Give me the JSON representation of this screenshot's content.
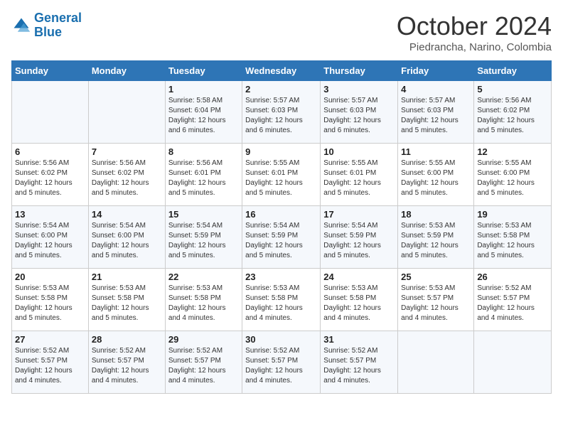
{
  "header": {
    "logo_line1": "General",
    "logo_line2": "Blue",
    "month": "October 2024",
    "location": "Piedrancha, Narino, Colombia"
  },
  "weekdays": [
    "Sunday",
    "Monday",
    "Tuesday",
    "Wednesday",
    "Thursday",
    "Friday",
    "Saturday"
  ],
  "weeks": [
    [
      {
        "day": "",
        "detail": ""
      },
      {
        "day": "",
        "detail": ""
      },
      {
        "day": "1",
        "detail": "Sunrise: 5:58 AM\nSunset: 6:04 PM\nDaylight: 12 hours\nand 6 minutes."
      },
      {
        "day": "2",
        "detail": "Sunrise: 5:57 AM\nSunset: 6:03 PM\nDaylight: 12 hours\nand 6 minutes."
      },
      {
        "day": "3",
        "detail": "Sunrise: 5:57 AM\nSunset: 6:03 PM\nDaylight: 12 hours\nand 6 minutes."
      },
      {
        "day": "4",
        "detail": "Sunrise: 5:57 AM\nSunset: 6:03 PM\nDaylight: 12 hours\nand 5 minutes."
      },
      {
        "day": "5",
        "detail": "Sunrise: 5:56 AM\nSunset: 6:02 PM\nDaylight: 12 hours\nand 5 minutes."
      }
    ],
    [
      {
        "day": "6",
        "detail": "Sunrise: 5:56 AM\nSunset: 6:02 PM\nDaylight: 12 hours\nand 5 minutes."
      },
      {
        "day": "7",
        "detail": "Sunrise: 5:56 AM\nSunset: 6:02 PM\nDaylight: 12 hours\nand 5 minutes."
      },
      {
        "day": "8",
        "detail": "Sunrise: 5:56 AM\nSunset: 6:01 PM\nDaylight: 12 hours\nand 5 minutes."
      },
      {
        "day": "9",
        "detail": "Sunrise: 5:55 AM\nSunset: 6:01 PM\nDaylight: 12 hours\nand 5 minutes."
      },
      {
        "day": "10",
        "detail": "Sunrise: 5:55 AM\nSunset: 6:01 PM\nDaylight: 12 hours\nand 5 minutes."
      },
      {
        "day": "11",
        "detail": "Sunrise: 5:55 AM\nSunset: 6:00 PM\nDaylight: 12 hours\nand 5 minutes."
      },
      {
        "day": "12",
        "detail": "Sunrise: 5:55 AM\nSunset: 6:00 PM\nDaylight: 12 hours\nand 5 minutes."
      }
    ],
    [
      {
        "day": "13",
        "detail": "Sunrise: 5:54 AM\nSunset: 6:00 PM\nDaylight: 12 hours\nand 5 minutes."
      },
      {
        "day": "14",
        "detail": "Sunrise: 5:54 AM\nSunset: 6:00 PM\nDaylight: 12 hours\nand 5 minutes."
      },
      {
        "day": "15",
        "detail": "Sunrise: 5:54 AM\nSunset: 5:59 PM\nDaylight: 12 hours\nand 5 minutes."
      },
      {
        "day": "16",
        "detail": "Sunrise: 5:54 AM\nSunset: 5:59 PM\nDaylight: 12 hours\nand 5 minutes."
      },
      {
        "day": "17",
        "detail": "Sunrise: 5:54 AM\nSunset: 5:59 PM\nDaylight: 12 hours\nand 5 minutes."
      },
      {
        "day": "18",
        "detail": "Sunrise: 5:53 AM\nSunset: 5:59 PM\nDaylight: 12 hours\nand 5 minutes."
      },
      {
        "day": "19",
        "detail": "Sunrise: 5:53 AM\nSunset: 5:58 PM\nDaylight: 12 hours\nand 5 minutes."
      }
    ],
    [
      {
        "day": "20",
        "detail": "Sunrise: 5:53 AM\nSunset: 5:58 PM\nDaylight: 12 hours\nand 5 minutes."
      },
      {
        "day": "21",
        "detail": "Sunrise: 5:53 AM\nSunset: 5:58 PM\nDaylight: 12 hours\nand 5 minutes."
      },
      {
        "day": "22",
        "detail": "Sunrise: 5:53 AM\nSunset: 5:58 PM\nDaylight: 12 hours\nand 4 minutes."
      },
      {
        "day": "23",
        "detail": "Sunrise: 5:53 AM\nSunset: 5:58 PM\nDaylight: 12 hours\nand 4 minutes."
      },
      {
        "day": "24",
        "detail": "Sunrise: 5:53 AM\nSunset: 5:58 PM\nDaylight: 12 hours\nand 4 minutes."
      },
      {
        "day": "25",
        "detail": "Sunrise: 5:53 AM\nSunset: 5:57 PM\nDaylight: 12 hours\nand 4 minutes."
      },
      {
        "day": "26",
        "detail": "Sunrise: 5:52 AM\nSunset: 5:57 PM\nDaylight: 12 hours\nand 4 minutes."
      }
    ],
    [
      {
        "day": "27",
        "detail": "Sunrise: 5:52 AM\nSunset: 5:57 PM\nDaylight: 12 hours\nand 4 minutes."
      },
      {
        "day": "28",
        "detail": "Sunrise: 5:52 AM\nSunset: 5:57 PM\nDaylight: 12 hours\nand 4 minutes."
      },
      {
        "day": "29",
        "detail": "Sunrise: 5:52 AM\nSunset: 5:57 PM\nDaylight: 12 hours\nand 4 minutes."
      },
      {
        "day": "30",
        "detail": "Sunrise: 5:52 AM\nSunset: 5:57 PM\nDaylight: 12 hours\nand 4 minutes."
      },
      {
        "day": "31",
        "detail": "Sunrise: 5:52 AM\nSunset: 5:57 PM\nDaylight: 12 hours\nand 4 minutes."
      },
      {
        "day": "",
        "detail": ""
      },
      {
        "day": "",
        "detail": ""
      }
    ]
  ]
}
